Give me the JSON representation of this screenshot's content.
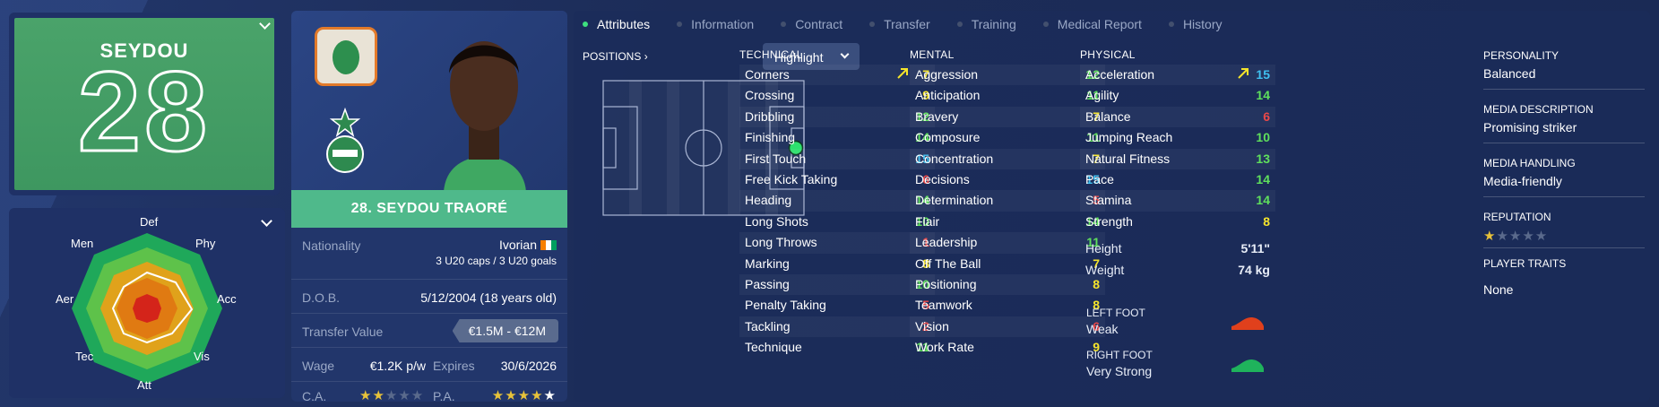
{
  "kit": {
    "name": "SEYDOU",
    "number": "28"
  },
  "radar": {
    "labels": {
      "def": "Def",
      "phy": "Phy",
      "acc": "Acc",
      "vis": "Vis",
      "att": "Att",
      "tec": "Tec",
      "aer": "Aer",
      "men": "Men"
    }
  },
  "profile": {
    "title": "28. SEYDOU TRAORÉ",
    "nationality_label": "Nationality",
    "nationality": "Ivorian",
    "caps": "3 U20 caps / 3 U20 goals",
    "dob_label": "D.O.B.",
    "dob": "5/12/2004 (18 years old)",
    "value_label": "Transfer Value",
    "value": "€1.5M - €12M",
    "wage_label": "Wage",
    "wage": "€1.2K p/w",
    "expires_label": "Expires",
    "expires": "30/6/2026",
    "ca_label": "C.A.",
    "pa_label": "P.A.",
    "ca_stars": 2,
    "pa_stars": 4.5
  },
  "tabs": [
    "Attributes",
    "Information",
    "Contract",
    "Transfer",
    "Training",
    "Medical Report",
    "History"
  ],
  "positions_label": "POSITIONS",
  "highlight_label": "Highlight",
  "technical": {
    "title": "TECHNICAL",
    "rows": [
      {
        "name": "Corners",
        "value": "7",
        "color": "#f5e42b",
        "trend": true
      },
      {
        "name": "Crossing",
        "value": "9",
        "color": "#f5e42b"
      },
      {
        "name": "Dribbling",
        "value": "12",
        "color": "#5fe05c"
      },
      {
        "name": "Finishing",
        "value": "14",
        "color": "#5fe05c"
      },
      {
        "name": "First Touch",
        "value": "15",
        "color": "#3fc0f0"
      },
      {
        "name": "Free Kick Taking",
        "value": "6",
        "color": "#ec4848"
      },
      {
        "name": "Heading",
        "value": "14",
        "color": "#5fe05c"
      },
      {
        "name": "Long Shots",
        "value": "10",
        "color": "#5fe05c"
      },
      {
        "name": "Long Throws",
        "value": "1",
        "color": "#ec4848"
      },
      {
        "name": "Marking",
        "value": "8",
        "color": "#f5e42b"
      },
      {
        "name": "Passing",
        "value": "10",
        "color": "#5fe05c"
      },
      {
        "name": "Penalty Taking",
        "value": "5",
        "color": "#ec4848"
      },
      {
        "name": "Tackling",
        "value": "2",
        "color": "#ec4848"
      },
      {
        "name": "Technique",
        "value": "11",
        "color": "#5fe05c"
      }
    ]
  },
  "mental": {
    "title": "MENTAL",
    "rows": [
      {
        "name": "Aggression",
        "value": "12",
        "color": "#5fe05c"
      },
      {
        "name": "Anticipation",
        "value": "11",
        "color": "#5fe05c"
      },
      {
        "name": "Bravery",
        "value": "7",
        "color": "#f5e42b"
      },
      {
        "name": "Composure",
        "value": "11",
        "color": "#5fe05c"
      },
      {
        "name": "Concentration",
        "value": "7",
        "color": "#f5e42b"
      },
      {
        "name": "Decisions",
        "value": "15",
        "color": "#3fc0f0"
      },
      {
        "name": "Determination",
        "value": "5",
        "color": "#ec4848"
      },
      {
        "name": "Flair",
        "value": "14",
        "color": "#5fe05c"
      },
      {
        "name": "Leadership",
        "value": "11",
        "color": "#5fe05c"
      },
      {
        "name": "Off The Ball",
        "value": "7",
        "color": "#f5e42b"
      },
      {
        "name": "Positioning",
        "value": "8",
        "color": "#f5e42b"
      },
      {
        "name": "Teamwork",
        "value": "8",
        "color": "#f5e42b"
      },
      {
        "name": "Vision",
        "value": "6",
        "color": "#ec4848"
      },
      {
        "name": "Work Rate",
        "value": "9",
        "color": "#f5e42b"
      }
    ]
  },
  "physical": {
    "title": "PHYSICAL",
    "rows": [
      {
        "name": "Acceleration",
        "value": "15",
        "color": "#3fc0f0",
        "trend": true
      },
      {
        "name": "Agility",
        "value": "14",
        "color": "#5fe05c"
      },
      {
        "name": "Balance",
        "value": "6",
        "color": "#ec4848"
      },
      {
        "name": "Jumping Reach",
        "value": "10",
        "color": "#5fe05c"
      },
      {
        "name": "Natural Fitness",
        "value": "13",
        "color": "#5fe05c"
      },
      {
        "name": "Pace",
        "value": "14",
        "color": "#5fe05c"
      },
      {
        "name": "Stamina",
        "value": "14",
        "color": "#5fe05c"
      },
      {
        "name": "Strength",
        "value": "8",
        "color": "#f5e42b"
      }
    ]
  },
  "height_label": "Height",
  "height": "5'11\"",
  "weight_label": "Weight",
  "weight": "74 kg",
  "left_foot_label": "LEFT FOOT",
  "left_foot": "Weak",
  "right_foot_label": "RIGHT FOOT",
  "right_foot": "Very Strong",
  "personality_label": "PERSONALITY",
  "personality": "Balanced",
  "media_desc_label": "MEDIA DESCRIPTION",
  "media_desc": "Promising striker",
  "media_handling_label": "MEDIA HANDLING",
  "media_handling": "Media-friendly",
  "reputation_label": "REPUTATION",
  "reputation_stars": 1,
  "traits_label": "PLAYER TRAITS",
  "traits": "None",
  "colors": {
    "accent": "#3ee07f",
    "header_bar": "#4fb98b",
    "star": "#e7c23a"
  }
}
